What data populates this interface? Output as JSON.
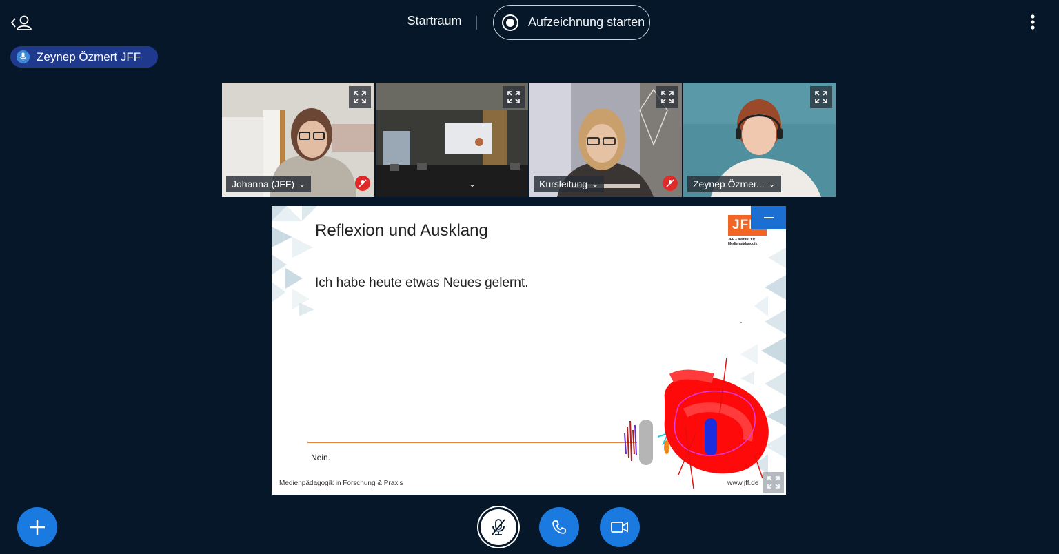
{
  "header": {
    "room_name": "Startraum",
    "record_label": "Aufzeichnung starten"
  },
  "talking": {
    "name": "Zeynep Özmert JFF"
  },
  "videos": [
    {
      "name": "Johanna (JFF)",
      "muted": true
    },
    {
      "name": "",
      "muted": false
    },
    {
      "name": "Kursleitung",
      "muted": true
    },
    {
      "name": "Zeynep Özmer...",
      "muted": false
    }
  ],
  "slide": {
    "title": "Reflexion und Ausklang",
    "body": "Ich habe heute etwas Neues gelernt.",
    "answer": "Nein.",
    "footer_left": "Medienpädagogik in Forschung & Praxis",
    "footer_right": "www.jff.de",
    "logo_text": "JFF",
    "logo_subtitle_1": "JFF – Institut für",
    "logo_subtitle_2": "Medienpädagogik"
  },
  "colors": {
    "background": "#06172a",
    "accent": "#1b7ae0",
    "talking_badge": "#1f3a8c",
    "muted_badge": "#e02a2a",
    "logo_orange": "#f26522"
  }
}
